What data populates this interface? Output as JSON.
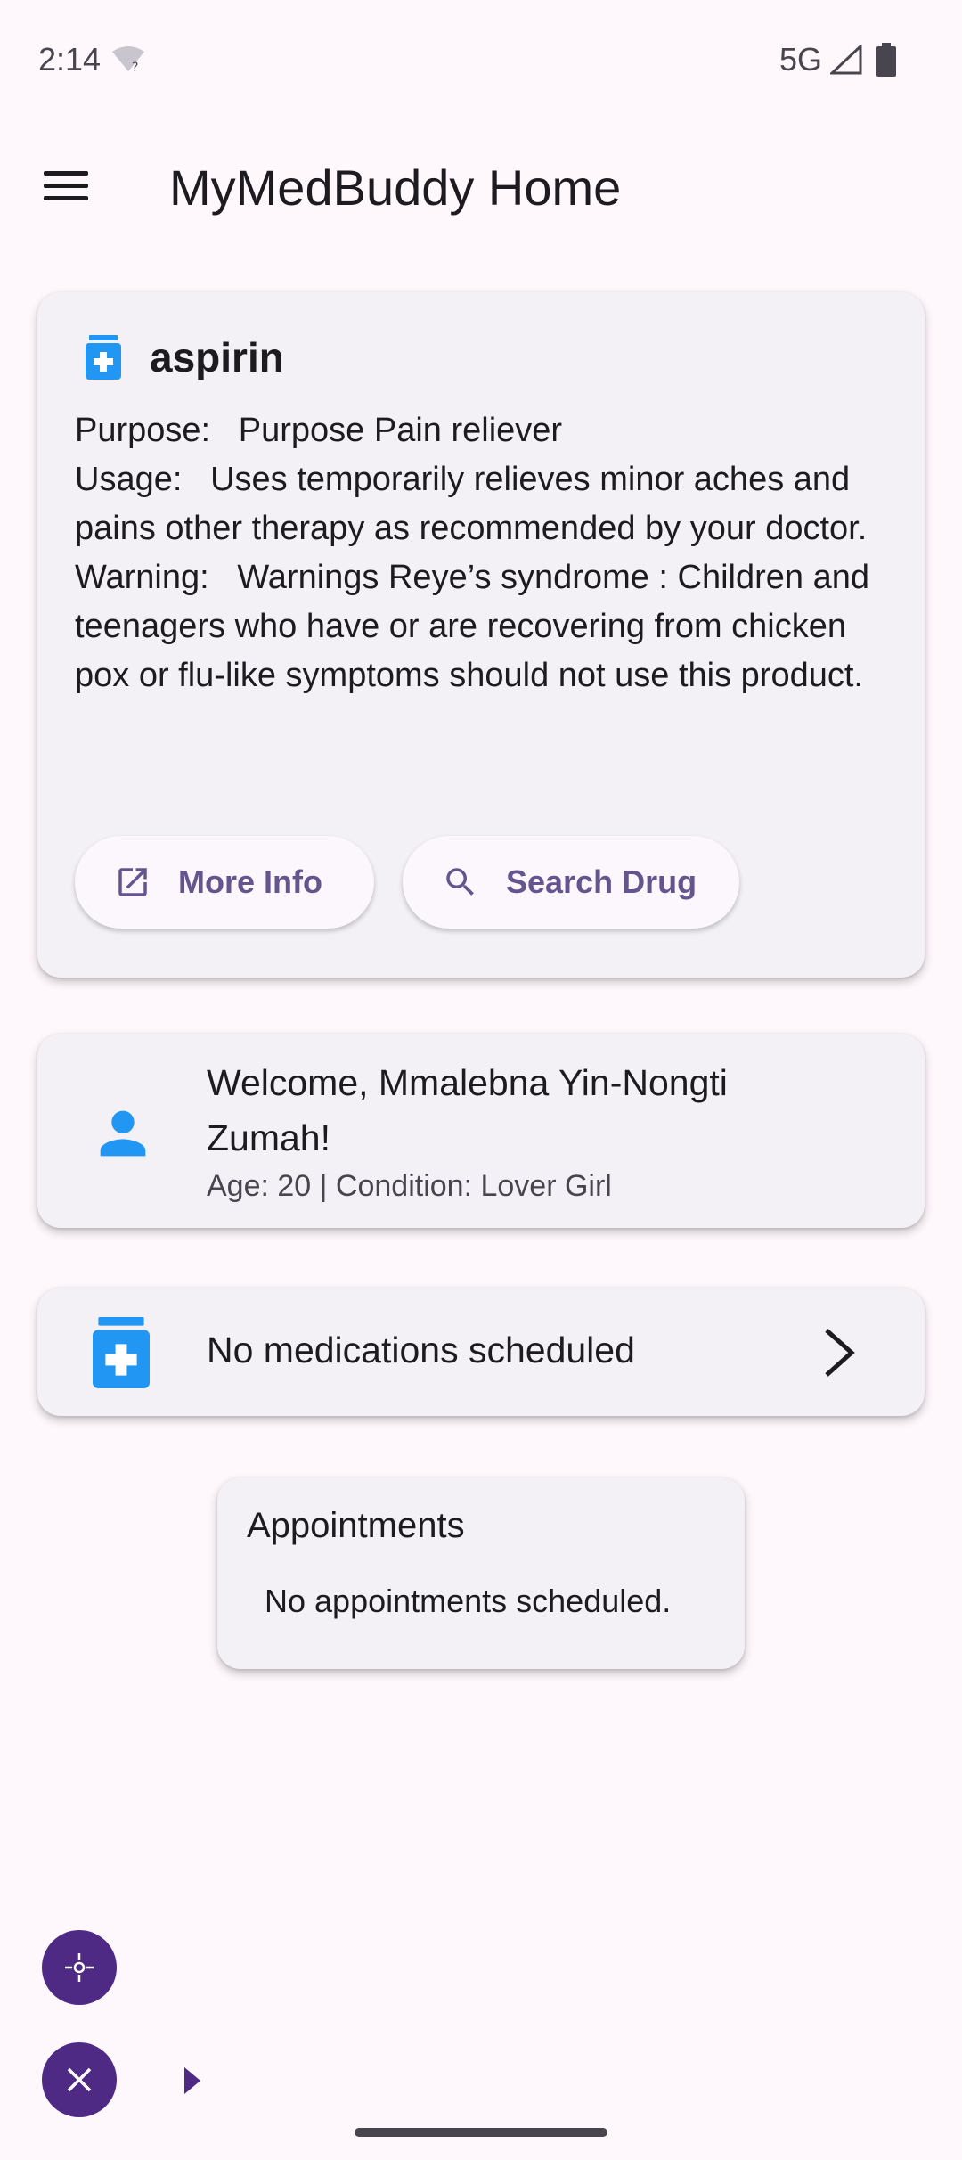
{
  "status_bar": {
    "time": "2:14",
    "network": "5G"
  },
  "app_bar": {
    "title": "MyMedBuddy Home"
  },
  "drug_card": {
    "name": "aspirin",
    "purpose_label": "Purpose:",
    "purpose_value": "Purpose Pain reliever",
    "usage_label": "Usage:",
    "usage_value": "Uses temporarily relieves minor aches and pains other therapy as recommended by your doctor.",
    "warning_label": "Warning:",
    "warning_value": "Warnings Reye’s syndrome : Children and teenagers who have or are recovering from chicken pox or flu-like symptoms should not use this product.",
    "more_info_label": "More Info",
    "search_drug_label": "Search Drug"
  },
  "welcome_card": {
    "greeting": "Welcome, Mmalebna Yin-Nongti Zumah!",
    "details": "Age: 20 | Condition: Lover Girl"
  },
  "medications_card": {
    "text": "No medications scheduled"
  },
  "appointments_card": {
    "title": "Appointments",
    "text": "No appointments scheduled."
  },
  "colors": {
    "background": "#fef7fc",
    "card": "#f4f1f6",
    "accent": "#65558f",
    "icon_blue": "#2196f3",
    "bubble": "#4e2a84"
  },
  "icons": {
    "drug": "medication-icon",
    "more_info": "open-in-new-icon",
    "search": "search-icon",
    "person": "person-icon",
    "medication": "medication-icon",
    "chevron": "chevron-right-icon"
  }
}
